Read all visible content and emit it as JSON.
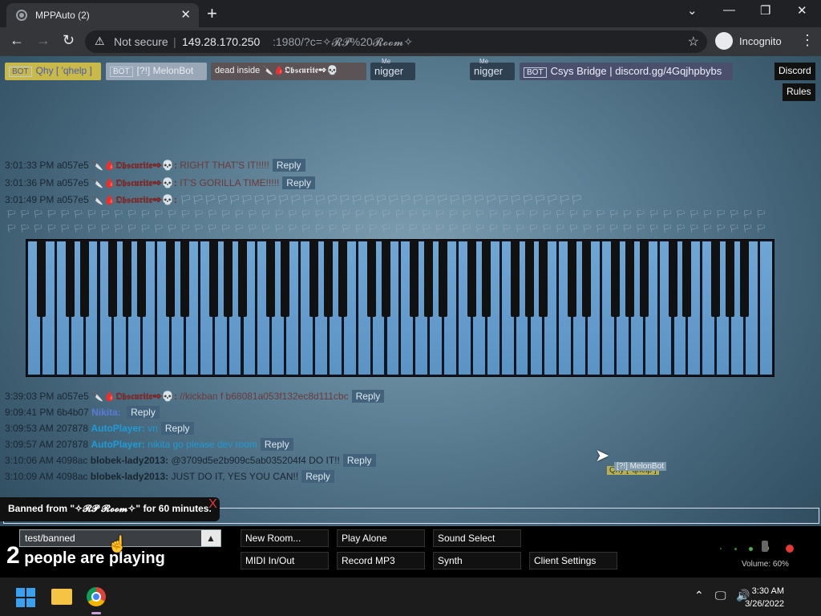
{
  "browser": {
    "tab_title": "MPPAuto (2)",
    "security_label": "Not secure",
    "url_host": "149.28.170.250",
    "url_rest": ":1980/?c=✧𝓡𝓟%20𝓡𝓸𝓸𝓶✧",
    "profile_label": "Incognito"
  },
  "userlist": [
    {
      "bot": "BOT",
      "name": "Qhy [ 'qhelp ]",
      "bg": "#c9b84a",
      "color": "#4a5aa8"
    },
    {
      "bot": "BOT",
      "name": "[?!] MelonBot",
      "bg": "#9aa7b6",
      "color": "#e8eef2"
    },
    {
      "bot": "",
      "name": "dead inside 🔪🩸𝕺𝖇𝖘𝖈𝖚𝖗𝖎𝖙𝖊✒💀",
      "bg": "#5b5356",
      "color": "#f2f2f2"
    },
    {
      "bot": "",
      "name": "nigger",
      "bg": "#2f4050",
      "color": "#dde6ee"
    },
    {
      "bot": "",
      "name": "nigger",
      "bg": "#2f4050",
      "color": "#dde6ee"
    },
    {
      "bot": "BOT",
      "name": "Csys Bridge | discord.gg/4Gqjhpbybs",
      "bg": "#4a4f6b",
      "color": "#eef"
    }
  ],
  "userlist_tags": {
    "me1": "Me",
    "me2": "Me"
  },
  "top_buttons": {
    "discord": "Discord",
    "rules": "Rules"
  },
  "chat": [
    {
      "time": "3:01:33 PM",
      "id": "a057e5",
      "name": "🔪🩸𝕺𝖇𝖘𝖈𝖚𝖗𝖎𝖙𝖊✒💀:",
      "name_color": "#7a2a2a",
      "text": "RIGHT THAT'S IT!!!!!",
      "text_color": "#6b3a3a",
      "reply": "Reply"
    },
    {
      "time": "3:01:36 PM",
      "id": "a057e5",
      "name": "🔪🩸𝕺𝖇𝖘𝖈𝖚𝖗𝖎𝖙𝖊✒💀:",
      "name_color": "#7a2a2a",
      "text": "IT'S GORILLA TIME!!!!!",
      "text_color": "#6b3a3a",
      "reply": "Reply"
    },
    {
      "time": "3:01:49 PM",
      "id": "a057e5",
      "name": "🔪🩸𝕺𝖇𝖘𝖈𝖚𝖗𝖎𝖙𝖊✒💀:",
      "name_color": "#7a2a2a",
      "text": "🏳🏳🏳🏳🏳🏳🏳🏳🏳🏳🏳🏳🏳🏳🏳🏳🏳🏳🏳🏳🏳🏳🏳🏳🏳🏳🏳🏳🏳🏳🏳🏳🏳",
      "text_color": "#9fb3c2",
      "reply": ""
    },
    {
      "time": "3:39:03 PM",
      "id": "a057e5",
      "name": "🔪🩸𝕺𝖇𝖘𝖈𝖚𝖗𝖎𝖙𝖊✒💀:",
      "name_color": "#7a2a2a",
      "text": "//kickban f b68081a053f132ec8d111cbc",
      "text_color": "#6b3a3a",
      "reply": "Reply"
    },
    {
      "time": "9:09:41 PM",
      "id": "6b4b07",
      "name": "Nikita:",
      "name_color": "#5a7ad6",
      "text": "",
      "text_color": "#5a7ad6",
      "reply": "Reply"
    },
    {
      "time": "3:09:53 AM",
      "id": "207878",
      "name": "AutoPlayer:",
      "name_color": "#1e9bd6",
      "text": "vn",
      "text_color": "#1e9bd6",
      "reply": "Reply"
    },
    {
      "time": "3:09:57 AM",
      "id": "207878",
      "name": "AutoPlayer:",
      "name_color": "#1e9bd6",
      "text": "nikita go please dev room",
      "text_color": "#1e9bd6",
      "reply": "Reply"
    },
    {
      "time": "3:10:06 AM",
      "id": "4098ac",
      "name": "blobek-lady2013:",
      "name_color": "#1b2530",
      "text": "@3709d5e2b909c5ab035204f4 DO IT!!",
      "text_color": "#1b2530",
      "reply": "Reply"
    },
    {
      "time": "3:10:09 AM",
      "id": "4098ac",
      "name": "blobek-lady2013:",
      "name_color": "#1b2530",
      "text": "JUST DO IT, YES YOU CAN!!",
      "text_color": "#1b2530",
      "reply": "Reply"
    }
  ],
  "flags": "🏳🏳🏳🏳🏳🏳🏳🏳🏳🏳🏳🏳🏳🏳🏳🏳🏳🏳🏳🏳🏳🏳🏳🏳🏳🏳🏳🏳🏳🏳🏳🏳🏳🏳🏳🏳🏳🏳🏳🏳🏳🏳🏳🏳🏳🏳🏳🏳🏳🏳🏳🏳🏳🏳🏳🏳🏳",
  "cursors": {
    "name1": "[?!] MelonBot",
    "name2": "Qhy [ 'qhelp ]"
  },
  "notice": {
    "text": "Banned from \"✧𝓡𝓟 𝓡𝓸𝓸𝓶✧\" for 60 minutes.",
    "close": "X"
  },
  "bottom": {
    "room": "test/banned",
    "players_count": "2",
    "players_text": " people are playing",
    "buttons": [
      "New Room...",
      "Play Alone",
      "Sound Select",
      "MIDI In/Out",
      "Record MP3",
      "Synth",
      "Client Settings"
    ],
    "volume": "Volume: 60%"
  },
  "taskbar": {
    "time": "3:30 AM",
    "date": "3/26/2022"
  }
}
